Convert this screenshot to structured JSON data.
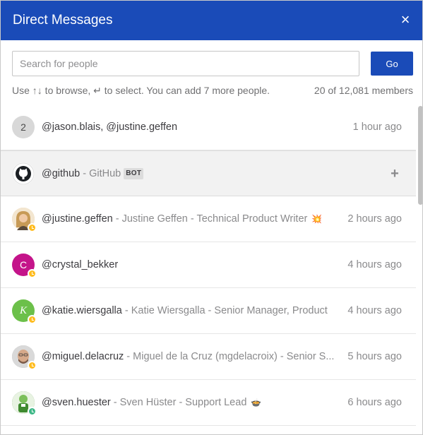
{
  "header": {
    "title": "Direct Messages",
    "close_glyph": "×"
  },
  "search": {
    "placeholder": "Search for people",
    "value": "",
    "go_label": "Go"
  },
  "hint": {
    "left": "Use ↑↓ to browse, ↵ to select. You can add 7 more people.",
    "right": "20 of 12,081 members"
  },
  "rows": [
    {
      "avatar_text": "2",
      "avatar_color": "#d8d8d8",
      "avatar_text_color": "#4a4a4a",
      "username": "@jason.blais, @justine.geffen",
      "details": "",
      "timestamp": "1 hour ago"
    },
    {
      "avatar_icon": "github-icon",
      "username": "@github",
      "details": " - GitHub",
      "bot_label": "BOT",
      "add_glyph": "+"
    },
    {
      "avatar_icon": "user-photo-icon",
      "avatar_color": "#e6c9a0",
      "username": "@justine.geffen",
      "details": " - Justine Geffen - Technical Product Writer",
      "emoji": "💥",
      "timestamp": "2 hours ago"
    },
    {
      "avatar_text": "C",
      "avatar_color": "#c4148a",
      "avatar_text_color": "#ffffff",
      "username": "@crystal_bekker",
      "details": "",
      "timestamp": "4 hours ago"
    },
    {
      "avatar_text": "K",
      "avatar_color": "#6cc04a",
      "avatar_text_color": "#ffffff",
      "username": "@katie.wiersgalla",
      "details": " - Katie Wiersgalla - Senior Manager, Product",
      "timestamp": "4 hours ago"
    },
    {
      "avatar_icon": "user-photo-icon",
      "avatar_color": "#b9b9b9",
      "username": "@miguel.delacruz",
      "details": " - Miguel de la Cruz (mgdelacroix) - Senior S...",
      "timestamp": "5 hours ago"
    },
    {
      "avatar_icon": "user-photo-icon",
      "avatar_color": "#4e8a3e",
      "username": "@sven.huester",
      "details": " - Sven Hüster - Support Lead",
      "emoji": "🍲",
      "timestamp": "6 hours ago"
    }
  ]
}
